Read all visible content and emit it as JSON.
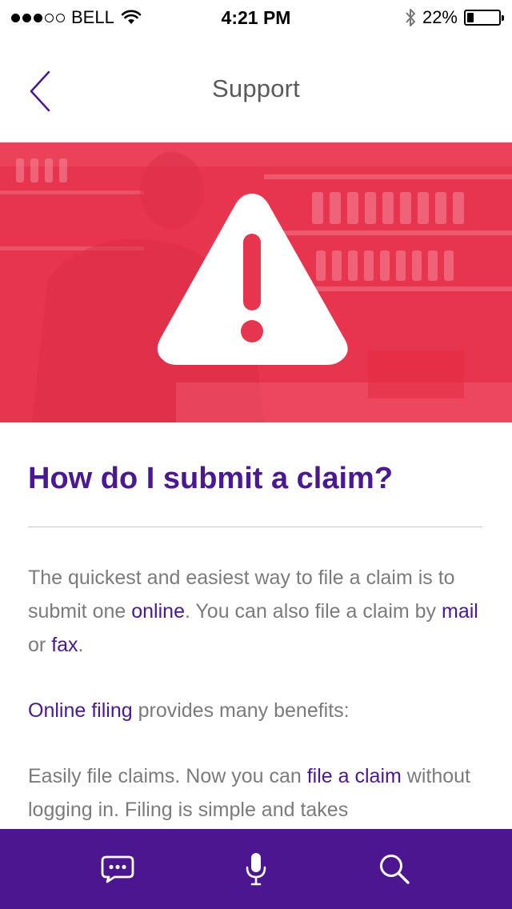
{
  "status": {
    "carrier": "BELL",
    "time": "4:21 PM",
    "battery_percent": "22%",
    "battery_level": 0.22,
    "signal_bars_filled": 3,
    "signal_bars_total": 5
  },
  "nav": {
    "title": "Support",
    "back_icon": "chevron-left-icon"
  },
  "hero": {
    "icon": "warning-triangle-icon",
    "color": "#e8354f"
  },
  "article": {
    "title": "How do I submit a claim?",
    "p1": {
      "text1": "The quickest and easiest way to file a claim is to submit one ",
      "link_online": "online",
      "text2": ". You can also file a claim by ",
      "link_mail": "mail",
      "text3": " or ",
      "link_fax": "fax",
      "text4": "."
    },
    "p2": {
      "link_online_filing": "Online filing",
      "text1": " provides many benefits:"
    },
    "p3": {
      "text1": "Easily file claims. Now you can ",
      "link_file_claim": "file a claim",
      "text2": " without logging in. Filing is simple and takes"
    }
  },
  "tabs": {
    "chat_icon": "chat-bubble-icon",
    "mic_icon": "microphone-icon",
    "search_icon": "search-icon"
  },
  "colors": {
    "accent": "#4a1890",
    "tabbar": "#4b1690",
    "hero": "#e8354f"
  }
}
